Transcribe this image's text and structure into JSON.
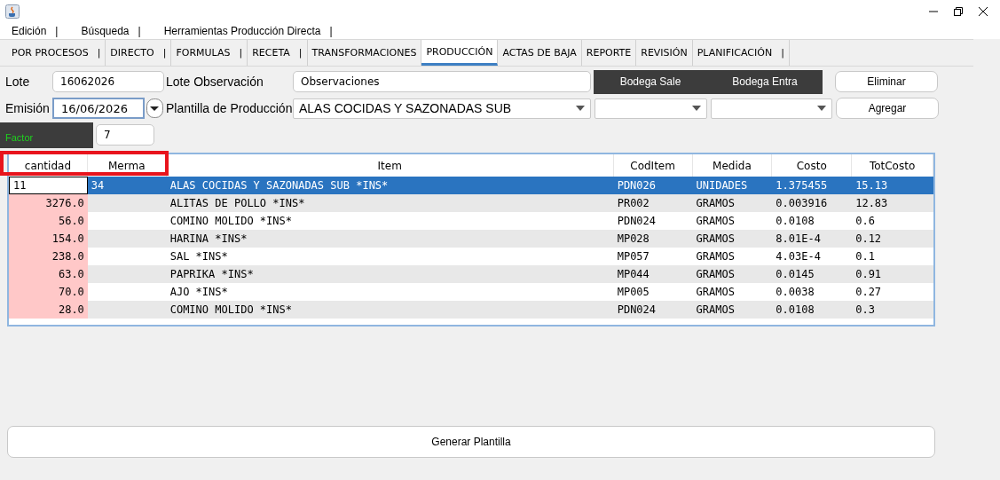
{
  "menu": [
    {
      "label": "Edición",
      "separator": "|"
    },
    {
      "label": "Búsqueda",
      "separator": "|"
    },
    {
      "label": "Herramientas Producción Directa",
      "separator": "|"
    }
  ],
  "tabs": [
    {
      "label": "POR PROCESOS",
      "separator": "|",
      "selected": false
    },
    {
      "label": "DIRECTO",
      "separator": "|",
      "selected": false
    },
    {
      "label": "FORMULAS",
      "separator": "|",
      "selected": false
    },
    {
      "label": "RECETA",
      "separator": "|",
      "selected": false
    },
    {
      "label": "TRANSFORMACIONES",
      "selected": false
    },
    {
      "label": "PRODUCCIÓN",
      "selected": true
    },
    {
      "label": "ACTAS DE BAJA",
      "selected": false
    },
    {
      "label": "REPORTE",
      "selected": false
    },
    {
      "label": "REVISIÓN",
      "selected": false
    },
    {
      "label": "PLANIFICACIÓN",
      "separator": "|",
      "selected": false
    }
  ],
  "form": {
    "lote": {
      "label": "Lote",
      "value": "16062026"
    },
    "lote_observacion": {
      "label": "Lote Observación",
      "value": "Observaciones"
    },
    "bodega_sale": "Bodega Sale",
    "bodega_entra": "Bodega Entra",
    "eliminar": "Eliminar",
    "emision": {
      "label": "Emisión",
      "value": "16/06/2026"
    },
    "plantilla": {
      "label": "Plantilla de Producción",
      "value": "ALAS COCIDAS Y SAZONADAS SUB"
    },
    "agregar": "Agregar",
    "factor": {
      "label": "Factor",
      "value": "7"
    }
  },
  "table": {
    "columns": [
      "cantidad",
      "Merma",
      "Item",
      "CodItem",
      "Medida",
      "Costo",
      "TotCosto"
    ],
    "rows": [
      {
        "selected": true,
        "editing": true,
        "cells": [
          "11",
          "34",
          "ALAS COCIDAS Y SAZONADAS SUB *INS*",
          "PDN026",
          "UNIDADES",
          "1.375455",
          "15.13"
        ]
      },
      {
        "selected": false,
        "editing": false,
        "cells": [
          "3276.0",
          "",
          "ALITAS DE POLLO *INS*",
          "PR002",
          "GRAMOS",
          "0.003916",
          "12.83"
        ]
      },
      {
        "selected": false,
        "editing": false,
        "cells": [
          "56.0",
          "",
          "COMINO MOLIDO *INS*",
          "PDN024",
          "GRAMOS",
          "0.0108",
          "0.6"
        ]
      },
      {
        "selected": false,
        "editing": false,
        "cells": [
          "154.0",
          "",
          "HARINA *INS*",
          "MP028",
          "GRAMOS",
          "8.01E-4",
          "0.12"
        ]
      },
      {
        "selected": false,
        "editing": false,
        "cells": [
          "238.0",
          "",
          "SAL *INS*",
          "MP057",
          "GRAMOS",
          "4.03E-4",
          "0.1"
        ]
      },
      {
        "selected": false,
        "editing": false,
        "cells": [
          "63.0",
          "",
          "PAPRIKA *INS*",
          "MP044",
          "GRAMOS",
          "0.0145",
          "0.91"
        ]
      },
      {
        "selected": false,
        "editing": false,
        "cells": [
          "70.0",
          "",
          "AJO *INS*",
          "MP005",
          "GRAMOS",
          "0.0038",
          "0.27"
        ]
      },
      {
        "selected": false,
        "editing": false,
        "cells": [
          "28.0",
          "",
          "COMINO MOLIDO *INS*",
          "PDN024",
          "GRAMOS",
          "0.0108",
          "0.3"
        ]
      }
    ]
  },
  "generate_button": "Generar Plantilla"
}
